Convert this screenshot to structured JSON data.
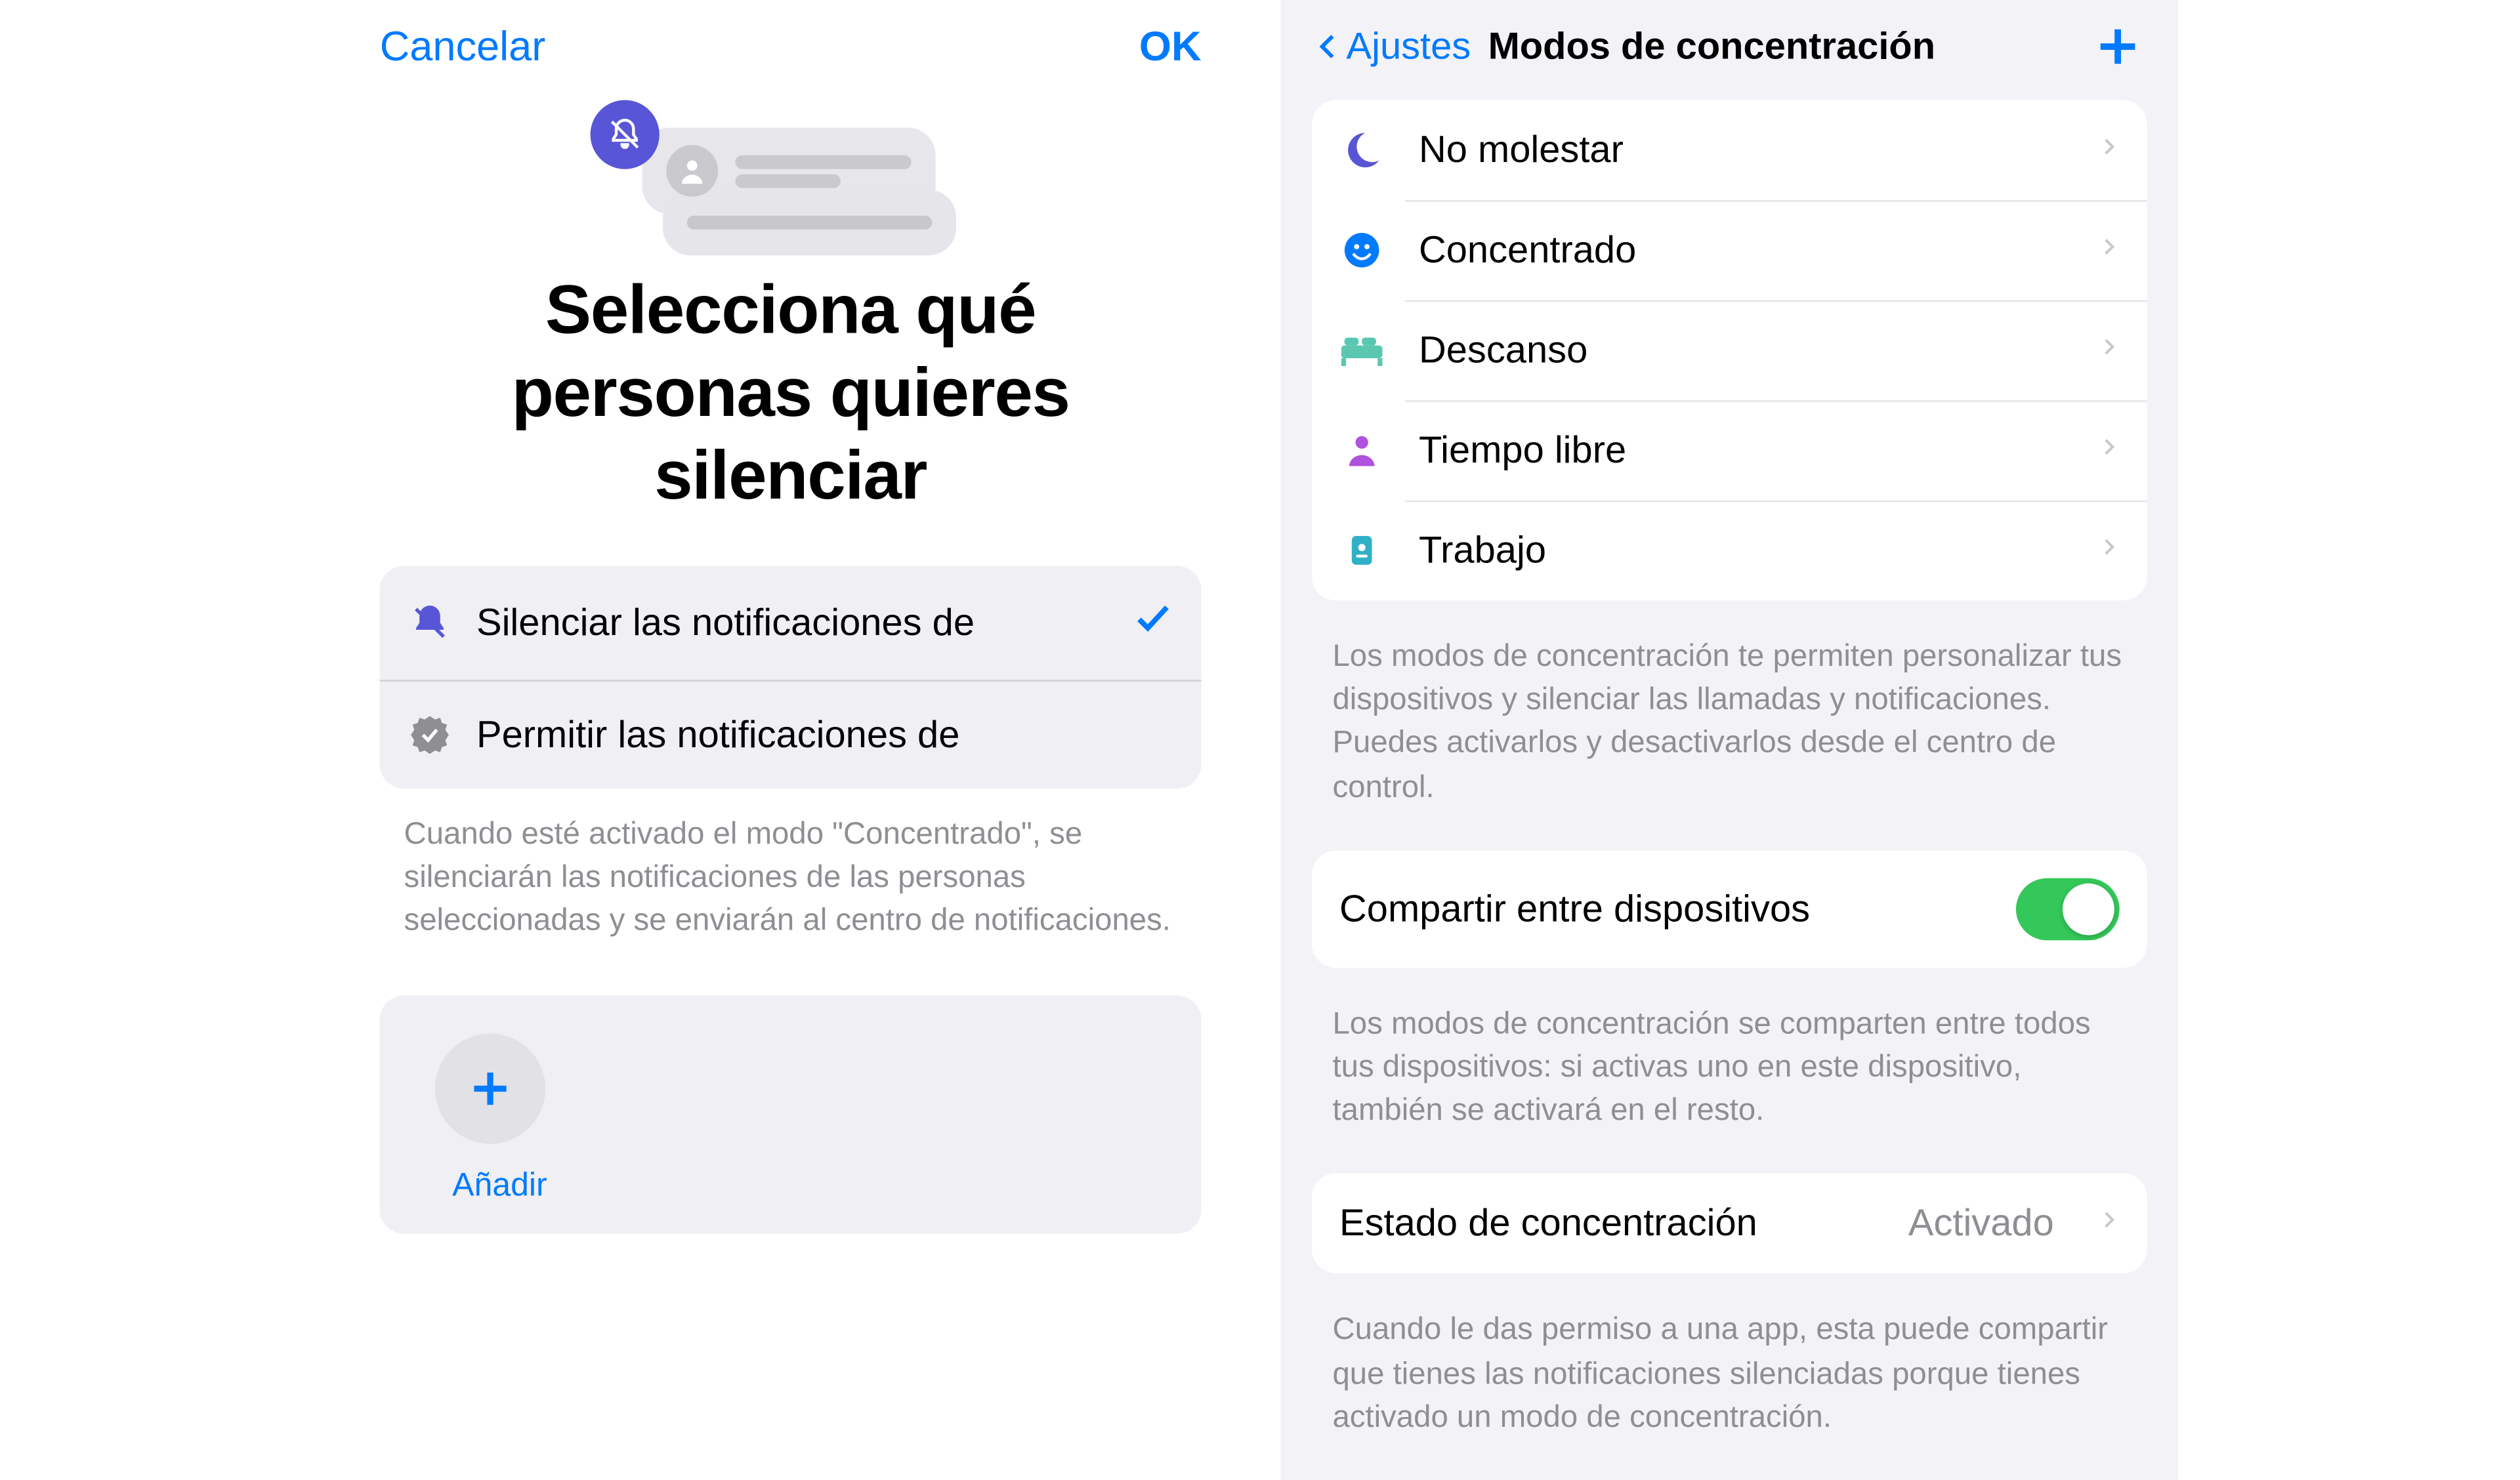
{
  "left": {
    "cancel": "Cancelar",
    "ok": "OK",
    "hero_title": "Selecciona qué personas quieres silenciar",
    "option_silence": "Silenciar las notificaciones de",
    "option_allow": "Permitir las notificaciones de",
    "footer": "Cuando esté activado el modo \"Concentrado\", se silenciarán las notificaciones de las personas seleccionadas y se enviarán al centro de notificaciones.",
    "add_label": "Añadir"
  },
  "right": {
    "back": "Ajustes",
    "title": "Modos de concentración",
    "modes": {
      "dnd": "No molestar",
      "concentrado": "Concentrado",
      "descanso": "Descanso",
      "tiempo_libre": "Tiempo libre",
      "trabajo": "Trabajo"
    },
    "modes_footer": "Los modos de concentración te permiten personalizar tus dispositivos y silenciar las llamadas y notificaciones. Puedes activarlos y desactivarlos desde el centro de control.",
    "share_label": "Compartir entre dispositivos",
    "share_footer": "Los modos de concentración se comparten entre todos tus dispositivos: si activas uno en este dispositivo, también se activará en el resto.",
    "status_label": "Estado de concentración",
    "status_value": "Activado",
    "status_footer": "Cuando le das permiso a una app, esta puede compartir que tienes las notificaciones silenciadas porque tienes activado un modo de concentración."
  }
}
